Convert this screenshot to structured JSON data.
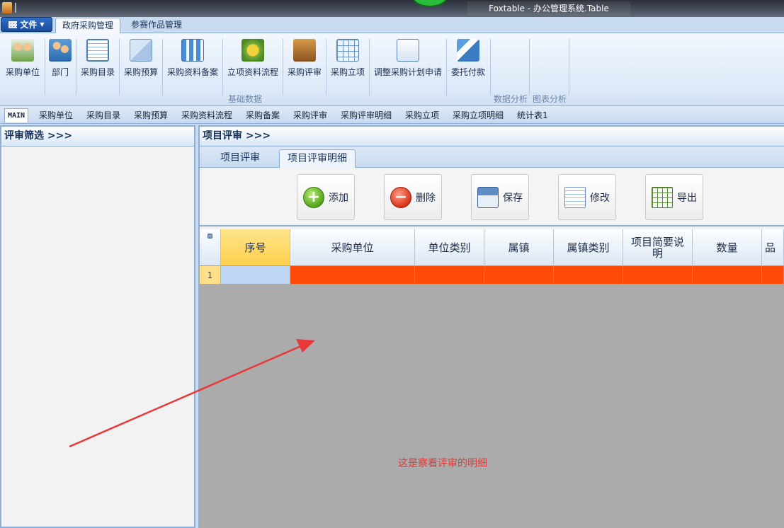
{
  "window": {
    "title": "Foxtable - 办公管理系统.Table"
  },
  "ribbon": {
    "file_label": "文件",
    "tabs": [
      {
        "label": "政府采购管理",
        "active": true
      },
      {
        "label": "参赛作品管理",
        "active": false
      }
    ],
    "buttons": [
      {
        "label": "采购单位",
        "icon": "purchasing-unit-icon"
      },
      {
        "label": "部门",
        "icon": "department-icon"
      },
      {
        "label": "采购目录",
        "icon": "catalog-icon"
      },
      {
        "label": "采购预算",
        "icon": "budget-icon"
      },
      {
        "label": "采购资料备案",
        "icon": "filing-icon"
      },
      {
        "label": "立项资料流程",
        "icon": "workflow-icon"
      },
      {
        "label": "采购评审",
        "icon": "review-icon"
      },
      {
        "label": "采购立项",
        "icon": "project-grid-icon"
      },
      {
        "label": "调整采购计划申请",
        "icon": "plan-adjust-icon"
      },
      {
        "label": "委托付款",
        "icon": "payment-icon"
      }
    ],
    "groups": [
      "基础数据",
      "数据分析",
      "图表分析"
    ]
  },
  "doc_tabs": [
    "MAIN",
    "采购单位",
    "采购目录",
    "采购预算",
    "采购资料流程",
    "采购备案",
    "采购评审",
    "采购评审明细",
    "采购立项",
    "采购立项明细",
    "统计表1"
  ],
  "left_panel": {
    "title": "评审筛选 >>>"
  },
  "right_panel": {
    "title": "项目评审 >>>",
    "sub_tabs": [
      {
        "label": "项目评审",
        "active": false
      },
      {
        "label": "项目评审明细",
        "active": true
      }
    ],
    "toolbar": [
      {
        "label": "添加",
        "icon": "add-icon"
      },
      {
        "label": "删除",
        "icon": "delete-icon"
      },
      {
        "label": "保存",
        "icon": "save-icon"
      },
      {
        "label": "修改",
        "icon": "edit-icon"
      },
      {
        "label": "导出",
        "icon": "export-excel-icon"
      }
    ],
    "table": {
      "columns": [
        "序号",
        "采购单位",
        "单位类别",
        "属镇",
        "属镇类别",
        "项目简要说明",
        "数量",
        "品"
      ],
      "rows": [
        {
          "row_number": "1"
        }
      ]
    },
    "annotation": "这是察看评审的明细"
  },
  "colors": {
    "row_highlight": "#ff4a08",
    "annotation": "#e03a3a",
    "accent": "#1b4c9a"
  }
}
